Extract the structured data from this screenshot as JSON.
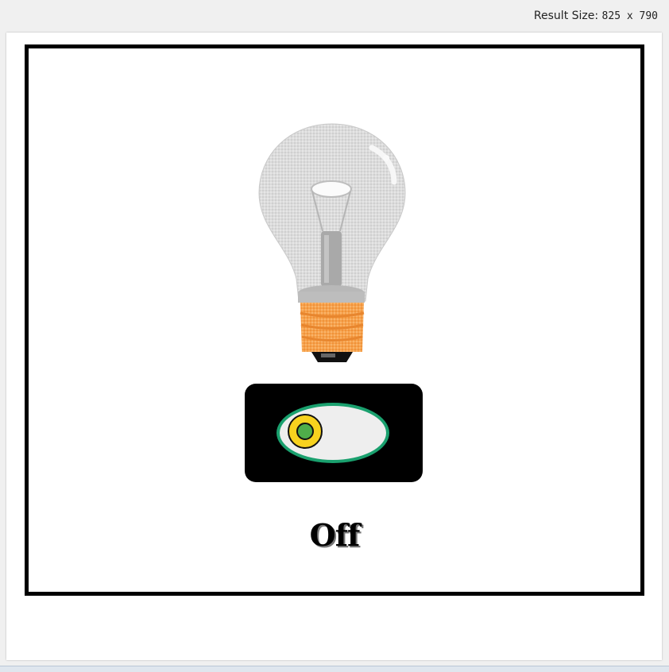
{
  "header": {
    "result_size_label": "Result Size:",
    "result_size_value": "825 x 790"
  },
  "lamp": {
    "state_label": "Off",
    "state": "off"
  },
  "colors": {
    "switch_body": "#000000",
    "switch_track": "#eeeeee",
    "switch_track_border": "#1aa06e",
    "switch_knob": "#f7d21e",
    "switch_knob_center": "#4fad4a",
    "bulb_base": "#f4a04a"
  },
  "icons": {
    "bulb": "light-bulb-icon",
    "toggle": "toggle-switch-icon"
  }
}
